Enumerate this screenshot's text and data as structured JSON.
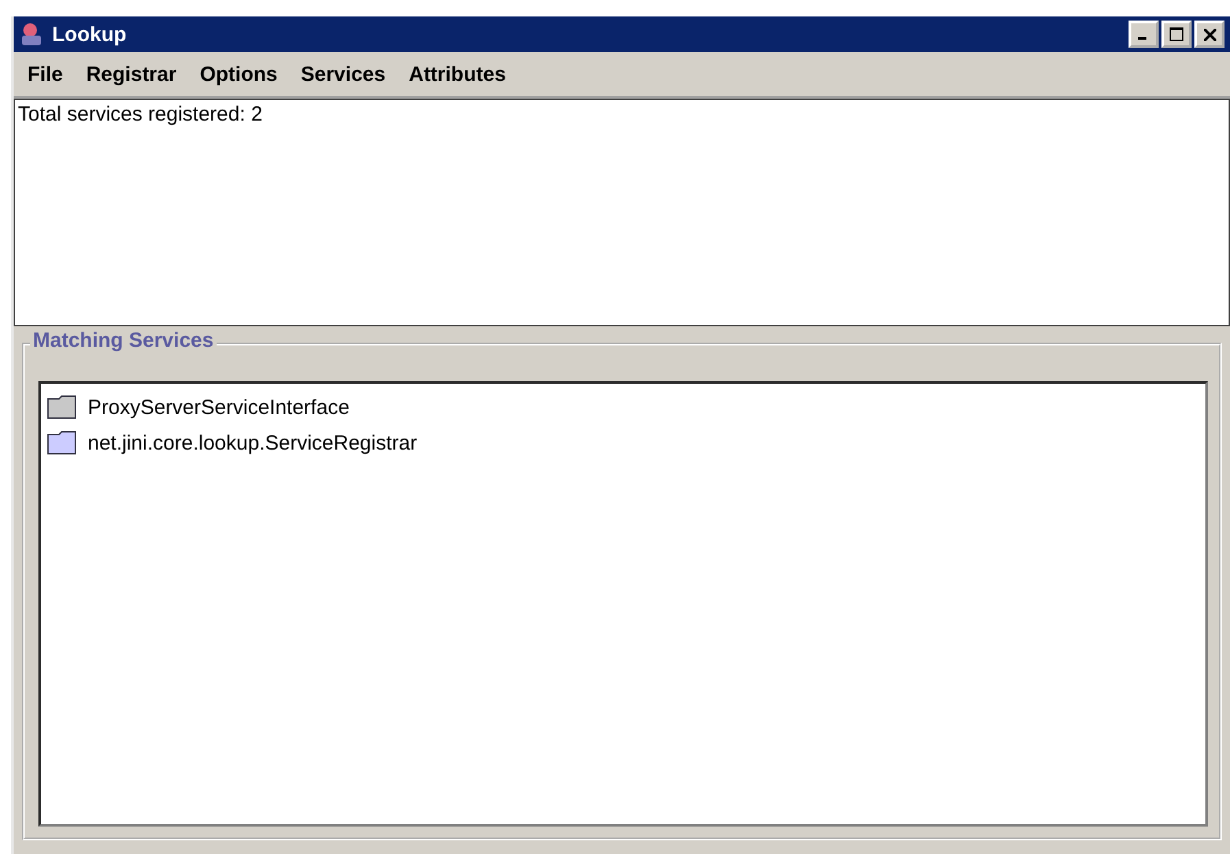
{
  "window": {
    "title": "Lookup"
  },
  "menu": [
    "File",
    "Registrar",
    "Options",
    "Services",
    "Attributes"
  ],
  "status_text": "Total services registered: 2",
  "matching_services": {
    "title": "Matching Services",
    "items": [
      {
        "label": "ProxyServerServiceInterface",
        "color": "#c8c8c8"
      },
      {
        "label": "net.jini.core.lookup.ServiceRegistrar",
        "color": "#ccccff"
      }
    ]
  }
}
